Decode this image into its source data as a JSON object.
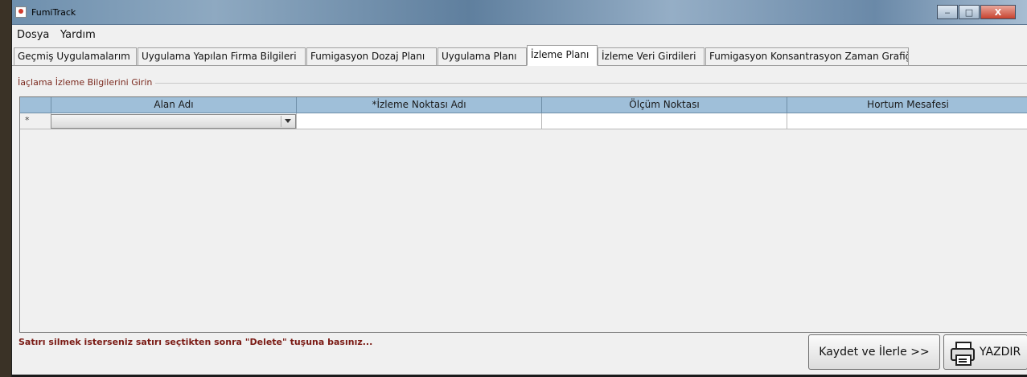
{
  "window": {
    "title": "FumiTrack",
    "minimize_label": "‒",
    "maximize_label": "□",
    "close_label": "X"
  },
  "menu": {
    "items": [
      "Dosya",
      "Yardım"
    ]
  },
  "tabs": [
    {
      "label": "Geçmiş Uygulamalarım",
      "active": false
    },
    {
      "label": "Uygulama Yapılan Firma Bilgileri",
      "active": false
    },
    {
      "label": "Fumigasyon Dozaj Planı",
      "active": false
    },
    {
      "label": "Uygulama Planı",
      "active": false
    },
    {
      "label": "İzleme Planı",
      "active": true
    },
    {
      "label": "İzleme Veri Girdileri",
      "active": false
    },
    {
      "label": "Fumigasyon Konsantrasyon Zaman Grafiği",
      "active": false
    }
  ],
  "panel": {
    "group_title": "İaçlama İzleme Bilgilerini Girin",
    "columns": [
      "Alan Adı",
      "*İzleme Noktası Adı",
      "Ölçüm Noktası",
      "Hortum Mesafesi"
    ],
    "new_row_marker": "*",
    "new_row": {
      "alan_adi": "",
      "izleme_noktasi_adi": "",
      "olcum_noktasi": "",
      "hortum_mesafesi": ""
    },
    "hint": "Satırı silmek isterseniz satırı seçtikten sonra \"Delete\" tuşuna basınız...",
    "save_label": "Kaydet ve İlerle >>",
    "print_label": "YAZDIR"
  }
}
